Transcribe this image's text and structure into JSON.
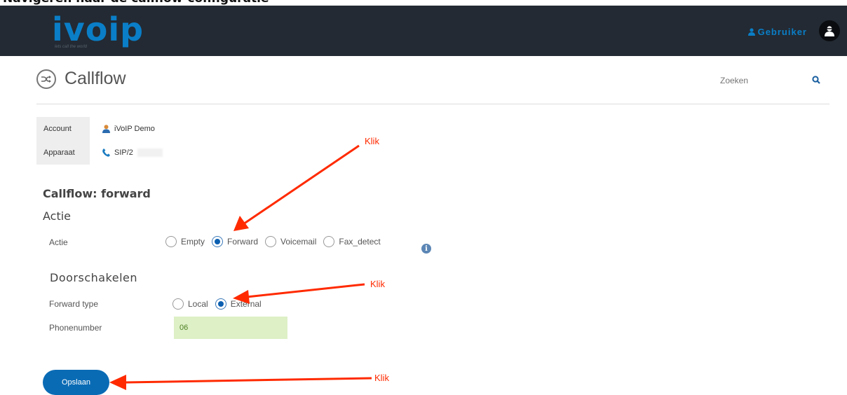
{
  "heading_fragment": "Navigeren naar de callflow-configuratie",
  "header": {
    "logo_text": "ivoip",
    "logo_tagline": "lets call the world",
    "user_label": "Gebruiker"
  },
  "page": {
    "title": "Callflow"
  },
  "search": {
    "placeholder": "Zoeken"
  },
  "info": {
    "account_label": "Account",
    "account_value": "iVoIP Demo",
    "device_label": "Apparaat",
    "device_value": "SIP/2"
  },
  "callflow_title": "Callflow: forward",
  "actie_section": {
    "heading": "Actie",
    "row_label": "Actie",
    "options": [
      "Empty",
      "Forward",
      "Voicemail",
      "Fax_detect"
    ],
    "selected": "Forward"
  },
  "door_section": {
    "heading": "Doorschakelen",
    "forward_type_label": "Forward type",
    "forward_options": [
      "Local",
      "External"
    ],
    "forward_selected": "External",
    "phonenumber_label": "Phonenumber",
    "phonenumber_value": "06"
  },
  "save_label": "Opslaan",
  "annotations": {
    "klik1": "Klik",
    "klik2": "Klik",
    "klik3": "Klik",
    "color": "#ff2a00"
  },
  "colors": {
    "brand": "#0a7ec7",
    "navbar": "#232a33",
    "button": "#0a6bb5",
    "field_bg": "#ddf0c6"
  },
  "icons": [
    "shuffle-icon",
    "search-icon",
    "user-icon",
    "avatar-icon",
    "phone-icon",
    "info-icon"
  ]
}
